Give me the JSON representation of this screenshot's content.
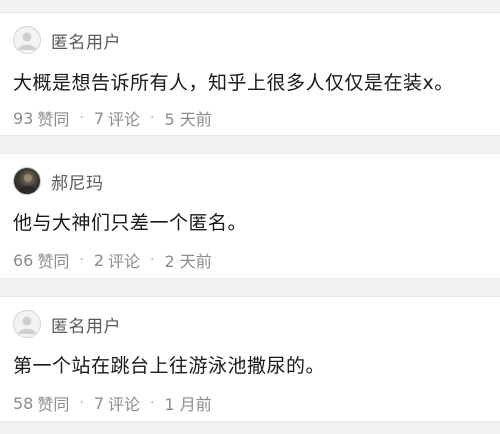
{
  "comments": [
    {
      "username": "匿名用户",
      "avatar": "anonymous-avatar",
      "text": "大概是想告诉所有人，知乎上很多人仅仅是在装x。",
      "likes": "93",
      "likes_label": "赞同",
      "comments_count": "7",
      "comments_label": "评论",
      "time": "5 天前",
      "separator": "·"
    },
    {
      "username": "郝尼玛",
      "avatar": "user-photo-avatar",
      "text": "他与大神们只差一个匿名。",
      "likes": "66",
      "likes_label": "赞同",
      "comments_count": "2",
      "comments_label": "评论",
      "time": "2 天前",
      "separator": "·"
    },
    {
      "username": "匿名用户",
      "avatar": "anonymous-avatar",
      "text": "第一个站在跳台上往游泳池撒尿的。",
      "likes": "58",
      "likes_label": "赞同",
      "comments_count": "7",
      "comments_label": "评论",
      "time": "1 月前",
      "separator": "·"
    }
  ],
  "colors": {
    "background": "#f2f2f3",
    "card": "#ffffff",
    "text": "#1a1a1a",
    "username": "#5a5a5e",
    "meta": "#8c8c90"
  }
}
